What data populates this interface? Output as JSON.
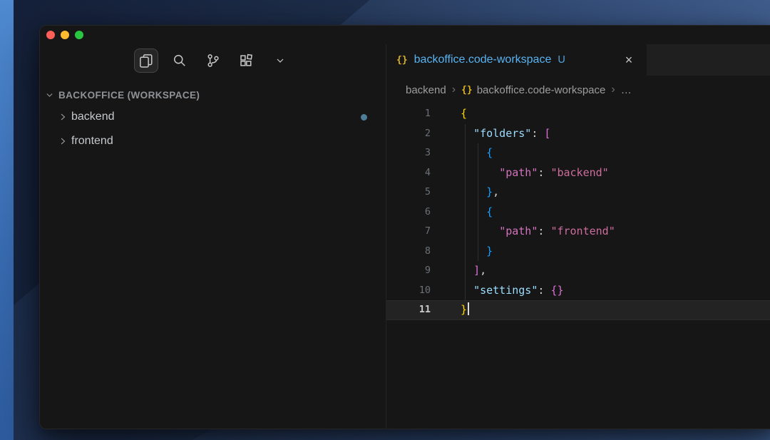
{
  "sidebar": {
    "toolbar_icons": [
      "explorer",
      "search",
      "source-control",
      "extensions",
      "more"
    ],
    "section_label": "BACKOFFICE (WORKSPACE)",
    "tree": [
      {
        "label": "backend",
        "modified_dot": true
      },
      {
        "label": "frontend",
        "modified_dot": false
      }
    ]
  },
  "editor": {
    "tab": {
      "icon_glyph": "{}",
      "title": "backoffice.code-workspace",
      "git_status": "U",
      "close_glyph": "×"
    },
    "breadcrumb": [
      {
        "label": "backend"
      },
      {
        "label": "backoffice.code-workspace",
        "icon_glyph": "{}"
      },
      {
        "label": "…"
      }
    ],
    "code": {
      "language": "json",
      "active_line": 11,
      "lines": [
        {
          "num": 1,
          "segments": [
            [
              "{",
              "y"
            ]
          ]
        },
        {
          "num": 2,
          "segments": [
            [
              "  ",
              "w"
            ],
            [
              "\"folders\"",
              "k"
            ],
            [
              ": ",
              "w"
            ],
            [
              "[",
              "p"
            ]
          ]
        },
        {
          "num": 3,
          "segments": [
            [
              "    ",
              "w"
            ],
            [
              "{",
              "b"
            ]
          ]
        },
        {
          "num": 4,
          "segments": [
            [
              "      ",
              "w"
            ],
            [
              "\"path\"",
              "pk"
            ],
            [
              ": ",
              "w"
            ],
            [
              "\"backend\"",
              "v"
            ]
          ]
        },
        {
          "num": 5,
          "segments": [
            [
              "    ",
              "w"
            ],
            [
              "}",
              "b"
            ],
            [
              ",",
              "w"
            ]
          ]
        },
        {
          "num": 6,
          "segments": [
            [
              "    ",
              "w"
            ],
            [
              "{",
              "b"
            ]
          ]
        },
        {
          "num": 7,
          "segments": [
            [
              "      ",
              "w"
            ],
            [
              "\"path\"",
              "pk"
            ],
            [
              ": ",
              "w"
            ],
            [
              "\"frontend\"",
              "v"
            ]
          ]
        },
        {
          "num": 8,
          "segments": [
            [
              "    ",
              "w"
            ],
            [
              "}",
              "b"
            ]
          ]
        },
        {
          "num": 9,
          "segments": [
            [
              "  ",
              "w"
            ],
            [
              "]",
              "p"
            ],
            [
              ",",
              "w"
            ]
          ]
        },
        {
          "num": 10,
          "segments": [
            [
              "  ",
              "w"
            ],
            [
              "\"settings\"",
              "k"
            ],
            [
              ": ",
              "w"
            ],
            [
              "{}",
              "p"
            ]
          ]
        },
        {
          "num": 11,
          "segments": [
            [
              "}",
              "y"
            ]
          ]
        }
      ]
    }
  },
  "colors": {
    "syntax": {
      "y": "#ffd700",
      "p": "#da70d6",
      "b": "#179fff",
      "k": "#9cdcfe",
      "pk": "#d373bd",
      "v": "#cd6d9d",
      "w": "#d4d4d4"
    },
    "tab_title": "#58b3f2",
    "json_icon": "#dcb327",
    "modified_dot": "#4e7d99",
    "current_line": "#232323"
  }
}
